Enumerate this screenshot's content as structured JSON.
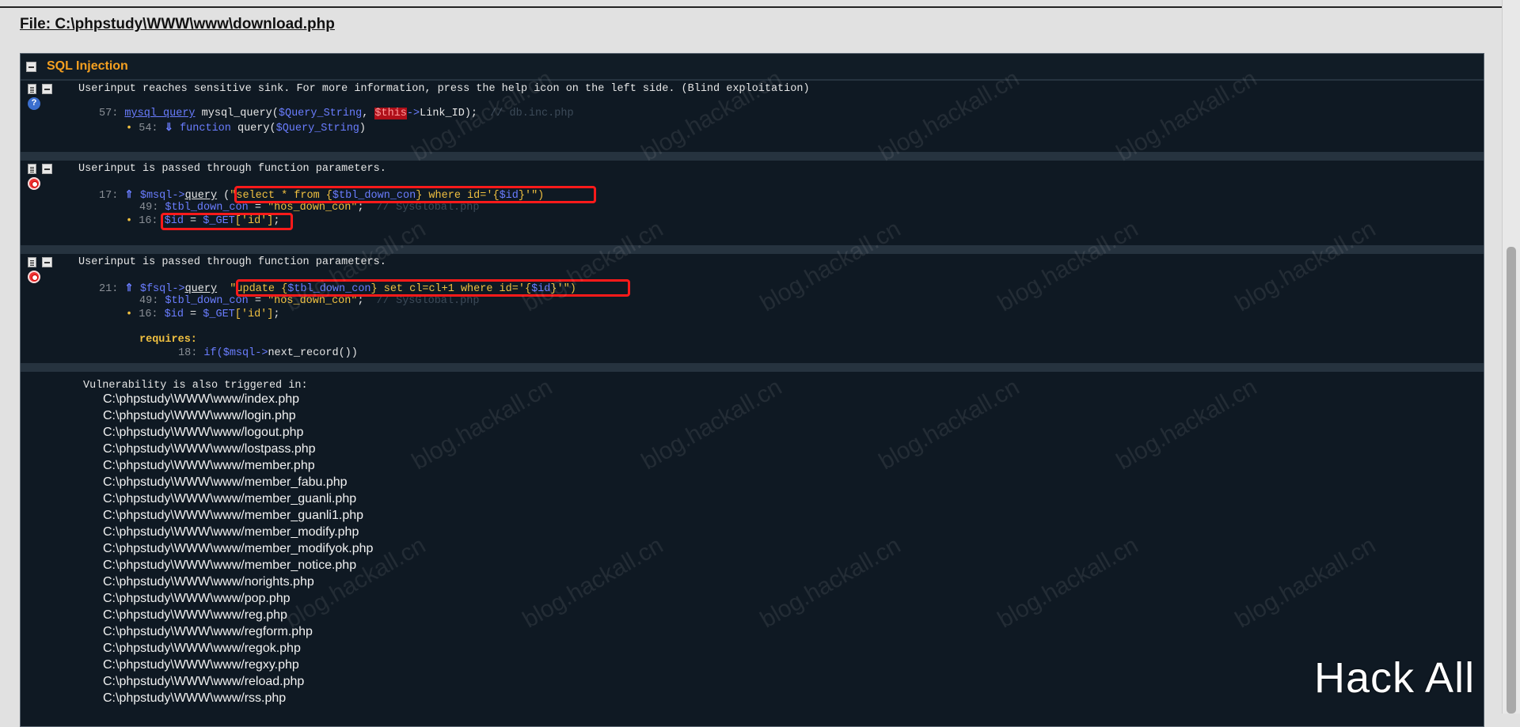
{
  "file_heading": "File: C:\\phpstudy\\WWW\\www\\download.php",
  "section_title": "SQL Injection",
  "vuln1": {
    "message": "Userinput reaches sensitive sink. For more information, press the help icon on the left side. (Blind exploitation)",
    "line1_no": "57:",
    "line1_sink": "mysql_query",
    "line1_code_a": " mysql_query(",
    "line1_var1": "$Query_String",
    "line1_code_b": ", ",
    "line1_this": "$this",
    "line1_arrow": "->",
    "line1_code_c": "Link_ID);",
    "line1_comment": "  // db.inc.php",
    "line2_no": "54:",
    "line2_kw": "function",
    "line2_code": " query(",
    "line2_var": "$Query_String",
    "line2_end": ")"
  },
  "vuln2": {
    "message": "Userinput is passed through function parameters.",
    "line1_no": "17:",
    "line1_var": "$msql->",
    "line1_fn": "query",
    "line1_code_a": " (",
    "line1_str_a": "\"select * from {",
    "line1_var2": "$tbl_down_con",
    "line1_str_b": "} where id='{",
    "line1_var3": "$id",
    "line1_str_c": "}'\")",
    "line2_no": "49:",
    "line2_var": "$tbl_down_con",
    "line2_eq": " = ",
    "line2_str": "\"hos_down_con\"",
    "line2_end": ";",
    "line2_comment": "  // SysGlobal.php",
    "line3_no": "16:",
    "line3_var": "$id",
    "line3_eq": " = ",
    "line3_get": "$_GET",
    "line3_str": "['id']",
    "line3_end": ";"
  },
  "vuln3": {
    "message": "Userinput is passed through function parameters.",
    "line1_no": "21:",
    "line1_var": "$fsql->",
    "line1_fn": "query",
    "line1_code_a": "  ",
    "line1_str_a": "\"update {",
    "line1_var2": "$tbl_down_con",
    "line1_str_b": "} set cl=cl+1 where id='{",
    "line1_var3": "$id",
    "line1_str_c": "}'\")",
    "line2_no": "49:",
    "line2_var": "$tbl_down_con",
    "line2_eq": " = ",
    "line2_str": "\"hos_down_con\"",
    "line2_end": ";",
    "line2_comment": "  // SysGlobal.php",
    "line3_no": "16:",
    "line3_var": "$id",
    "line3_eq": " = ",
    "line3_get": "$_GET",
    "line3_str": "['id']",
    "line3_end": ";",
    "requires_label": "requires:",
    "line4_no": "18:",
    "line4_kw": "if(",
    "line4_var": "$msql->",
    "line4_code": "next_record())"
  },
  "also_triggered": {
    "title": "Vulnerability is also triggered in:",
    "files": [
      "C:\\phpstudy\\WWW\\www/index.php",
      "C:\\phpstudy\\WWW\\www/login.php",
      "C:\\phpstudy\\WWW\\www/logout.php",
      "C:\\phpstudy\\WWW\\www/lostpass.php",
      "C:\\phpstudy\\WWW\\www/member.php",
      "C:\\phpstudy\\WWW\\www/member_fabu.php",
      "C:\\phpstudy\\WWW\\www/member_guanli.php",
      "C:\\phpstudy\\WWW\\www/member_guanli1.php",
      "C:\\phpstudy\\WWW\\www/member_modify.php",
      "C:\\phpstudy\\WWW\\www/member_modifyok.php",
      "C:\\phpstudy\\WWW\\www/member_notice.php",
      "C:\\phpstudy\\WWW\\www/norights.php",
      "C:\\phpstudy\\WWW\\www/pop.php",
      "C:\\phpstudy\\WWW\\www/reg.php",
      "C:\\phpstudy\\WWW\\www/regform.php",
      "C:\\phpstudy\\WWW\\www/regok.php",
      "C:\\phpstudy\\WWW\\www/regxy.php",
      "C:\\phpstudy\\WWW\\www/reload.php",
      "C:\\phpstudy\\WWW\\www/rss.php"
    ]
  },
  "watermark_text": "blog.hackall.cn",
  "brand_text": "Hack All",
  "icons": {
    "file": "file-icon",
    "collapse": "collapse-icon",
    "help": "help-icon",
    "target": "target-icon"
  }
}
